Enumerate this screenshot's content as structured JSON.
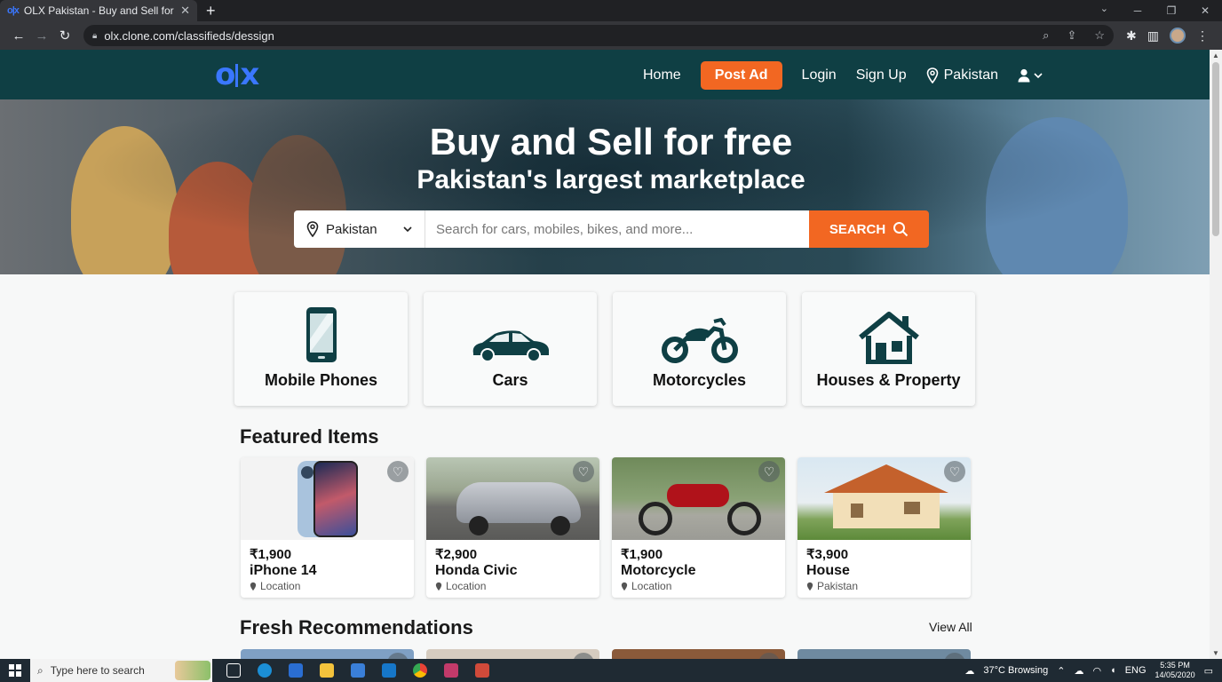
{
  "browser": {
    "tab_title": "OLX Pakistan - Buy and Sell for free",
    "url": "olx.clone.com/classifieds/dessign"
  },
  "nav": {
    "home": "Home",
    "post_ad": "Post Ad",
    "login": "Login",
    "signup": "Sign Up",
    "location": "Pakistan"
  },
  "hero": {
    "title": "Buy and Sell for free",
    "subtitle": "Pakistan's largest marketplace",
    "location_select": "Pakistan",
    "search_placeholder": "Search for cars, mobiles, bikes, and more...",
    "search_button": "SEARCH"
  },
  "categories": [
    {
      "label": "Mobile Phones",
      "icon": "mobile-phone-icon"
    },
    {
      "label": "Cars",
      "icon": "car-icon"
    },
    {
      "label": "Motorcycles",
      "icon": "motorcycle-icon"
    },
    {
      "label": "Houses & Property",
      "icon": "house-icon"
    }
  ],
  "featured": {
    "title": "Featured Items",
    "items": [
      {
        "price": "₹1,900",
        "name": "iPhone 14",
        "location": "Location"
      },
      {
        "price": "₹2,900",
        "name": "Honda Civic",
        "location": "Location"
      },
      {
        "price": "₹1,900",
        "name": "Motorcycle",
        "location": "Location"
      },
      {
        "price": "₹3,900",
        "name": "House",
        "location": "Pakistan"
      }
    ]
  },
  "fresh": {
    "title": "Fresh Recommendations",
    "view_all": "View All"
  },
  "taskbar": {
    "search_placeholder": "Type here to search",
    "weather": "37°C Browsing",
    "lang": "ENG",
    "time": "5:35 PM",
    "date": "14/05/2020"
  },
  "colors": {
    "nav_bg": "#0f3f44",
    "accent": "#f26722",
    "logo": "#3a77ff",
    "category_icon": "#0f3f44"
  }
}
